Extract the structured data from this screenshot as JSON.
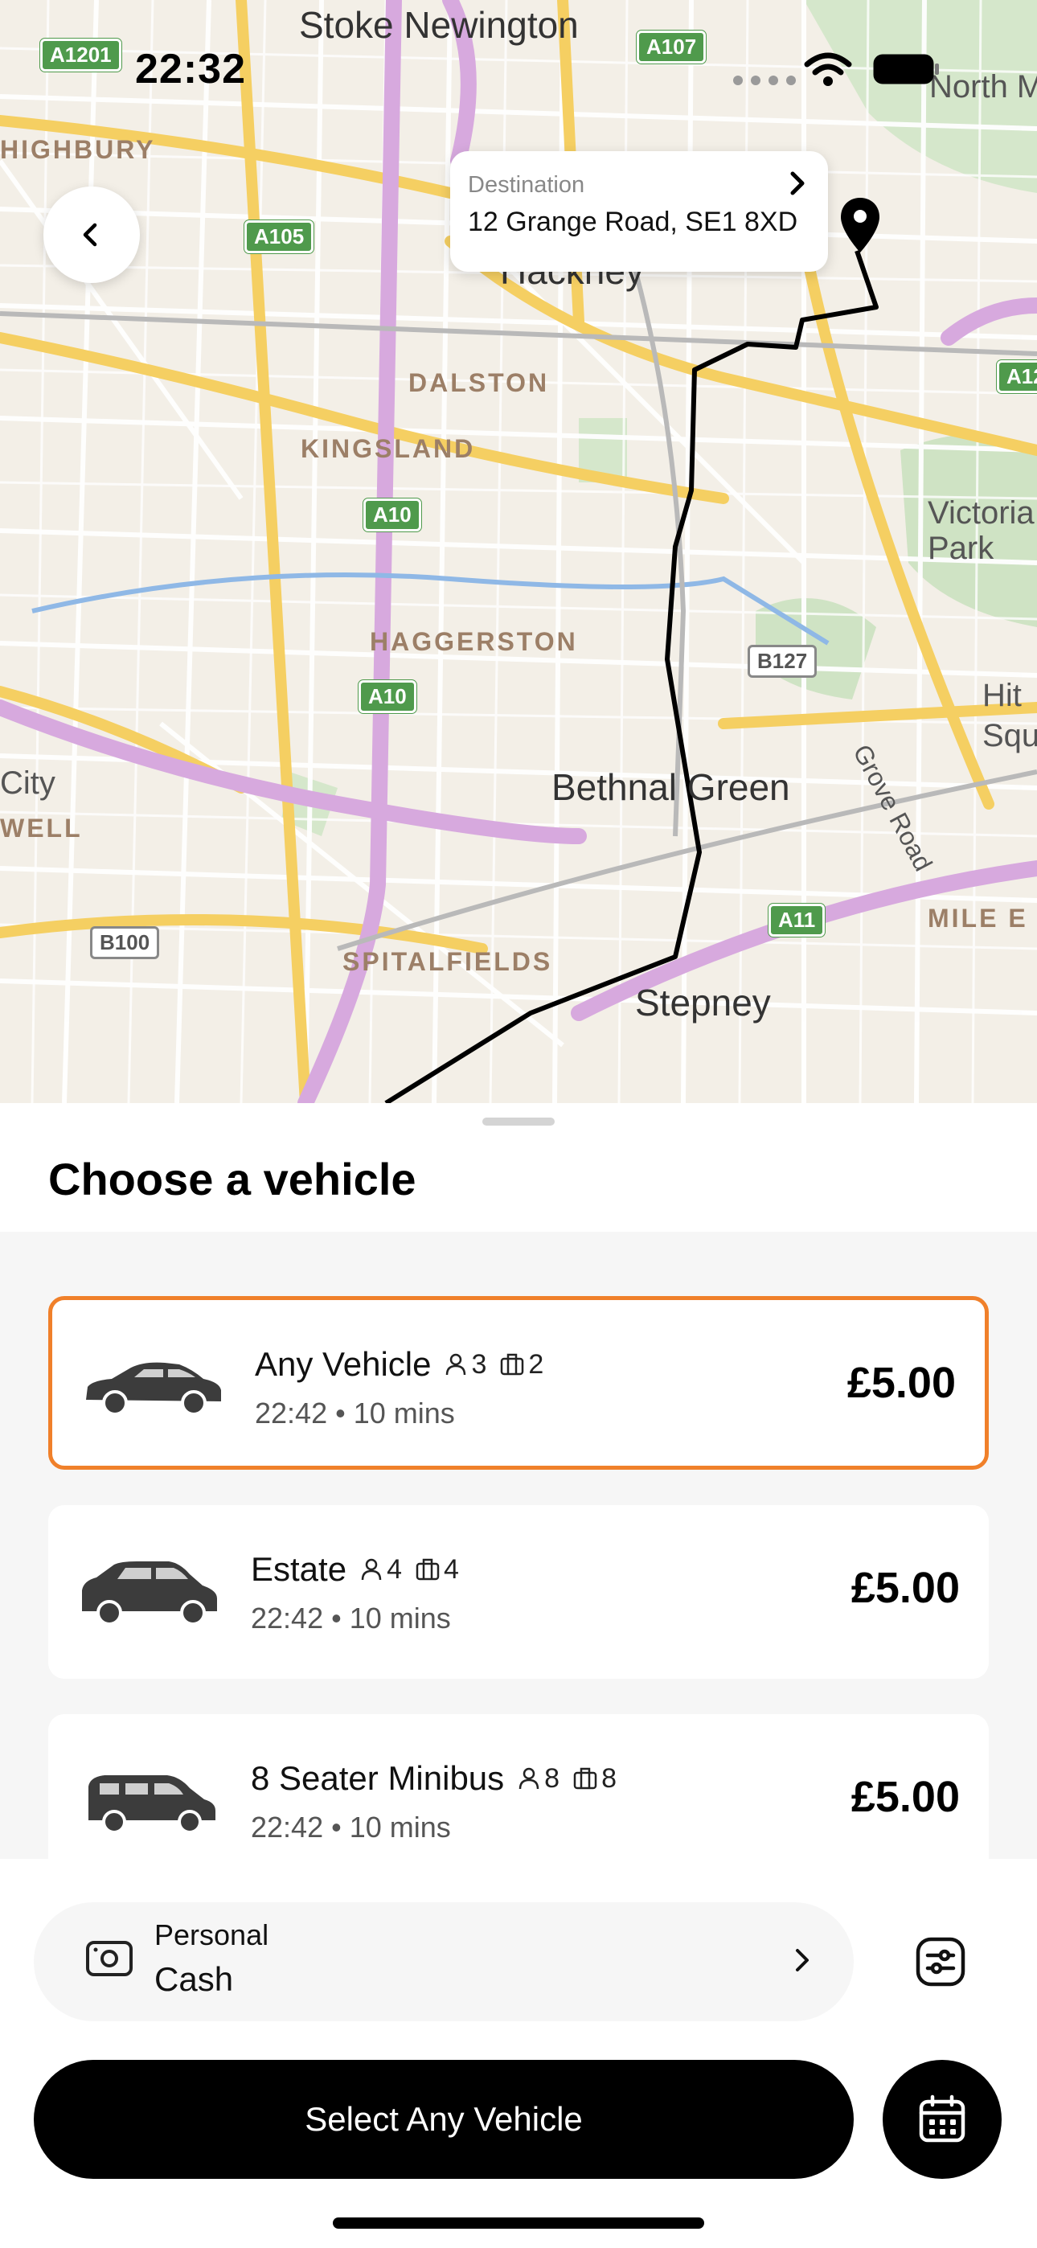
{
  "status_bar": {
    "time": "22:32"
  },
  "map": {
    "areas": [
      "DALSTON",
      "KINGSLAND",
      "HAGGERSTON",
      "SPITALFIELDS",
      "HIGHBURY",
      "WELL",
      "MILE E"
    ],
    "places": [
      "Stoke Newington",
      "Hackney",
      "Bethnal Green",
      "Stepney",
      "North M",
      "Victoria Park",
      "Hit Squ",
      "City"
    ],
    "roads": [
      "A1201",
      "A107",
      "A105",
      "A10",
      "A10",
      "B127",
      "B100",
      "A11",
      "A12"
    ],
    "street": "Grove Road"
  },
  "destination": {
    "label": "Destination",
    "address": "12 Grange Road, SE1 8XD"
  },
  "sheet": {
    "title": "Choose a vehicle"
  },
  "vehicles": [
    {
      "name": "Any Vehicle",
      "passengers": "3",
      "luggage": "2",
      "eta": "22:42 • 10 mins",
      "price": "£5.00",
      "selected": true
    },
    {
      "name": "Estate",
      "passengers": "4",
      "luggage": "4",
      "eta": "22:42 • 10 mins",
      "price": "£5.00",
      "selected": false
    },
    {
      "name": "8 Seater Minibus",
      "passengers": "8",
      "luggage": "8",
      "eta": "22:42 • 10 mins",
      "price": "£5.00",
      "selected": false
    }
  ],
  "payment": {
    "type": "Personal",
    "method": "Cash"
  },
  "actions": {
    "select_label": "Select Any Vehicle"
  },
  "colors": {
    "accent": "#f0802a",
    "primary": "#000000",
    "route": "#000000"
  },
  "icons": [
    "back-icon",
    "chevron-right-icon",
    "map-pin-icon",
    "wifi-icon",
    "battery-icon",
    "passenger-icon",
    "luggage-icon",
    "cash-icon",
    "filter-icon",
    "calendar-icon"
  ]
}
